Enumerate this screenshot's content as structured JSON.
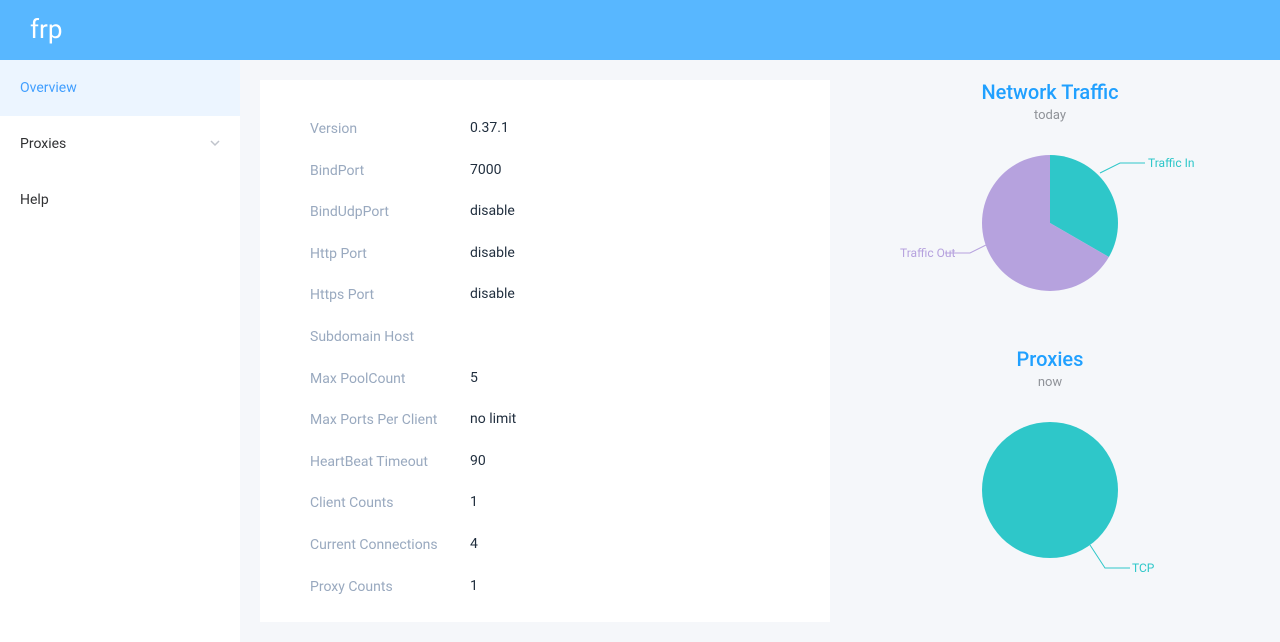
{
  "header": {
    "logo": "frp"
  },
  "sidebar": {
    "items": [
      {
        "label": "Overview"
      },
      {
        "label": "Proxies"
      },
      {
        "label": "Help"
      }
    ]
  },
  "info": {
    "rows": [
      {
        "label": "Version",
        "value": "0.37.1"
      },
      {
        "label": "BindPort",
        "value": "7000"
      },
      {
        "label": "BindUdpPort",
        "value": "disable"
      },
      {
        "label": "Http Port",
        "value": "disable"
      },
      {
        "label": "Https Port",
        "value": "disable"
      },
      {
        "label": "Subdomain Host",
        "value": ""
      },
      {
        "label": "Max PoolCount",
        "value": "5"
      },
      {
        "label": "Max Ports Per Client",
        "value": "no limit"
      },
      {
        "label": "HeartBeat Timeout",
        "value": "90"
      },
      {
        "label": "Client Counts",
        "value": "1"
      },
      {
        "label": "Current Connections",
        "value": "4"
      },
      {
        "label": "Proxy Counts",
        "value": "1"
      }
    ]
  },
  "charts": {
    "traffic": {
      "title": "Network Traffic",
      "subtitle": "today",
      "labels": {
        "in": "Traffic In",
        "out": "Traffic Out"
      }
    },
    "proxies": {
      "title": "Proxies",
      "subtitle": "now",
      "labels": {
        "tcp": "TCP"
      }
    }
  },
  "chart_data": [
    {
      "type": "pie",
      "title": "Network Traffic",
      "subtitle": "today",
      "series": [
        {
          "name": "Traffic In",
          "value": 33,
          "color": "#2ec7c9"
        },
        {
          "name": "Traffic Out",
          "value": 67,
          "color": "#b6a2de"
        }
      ]
    },
    {
      "type": "pie",
      "title": "Proxies",
      "subtitle": "now",
      "series": [
        {
          "name": "TCP",
          "value": 1,
          "color": "#2ec7c9"
        }
      ]
    }
  ]
}
